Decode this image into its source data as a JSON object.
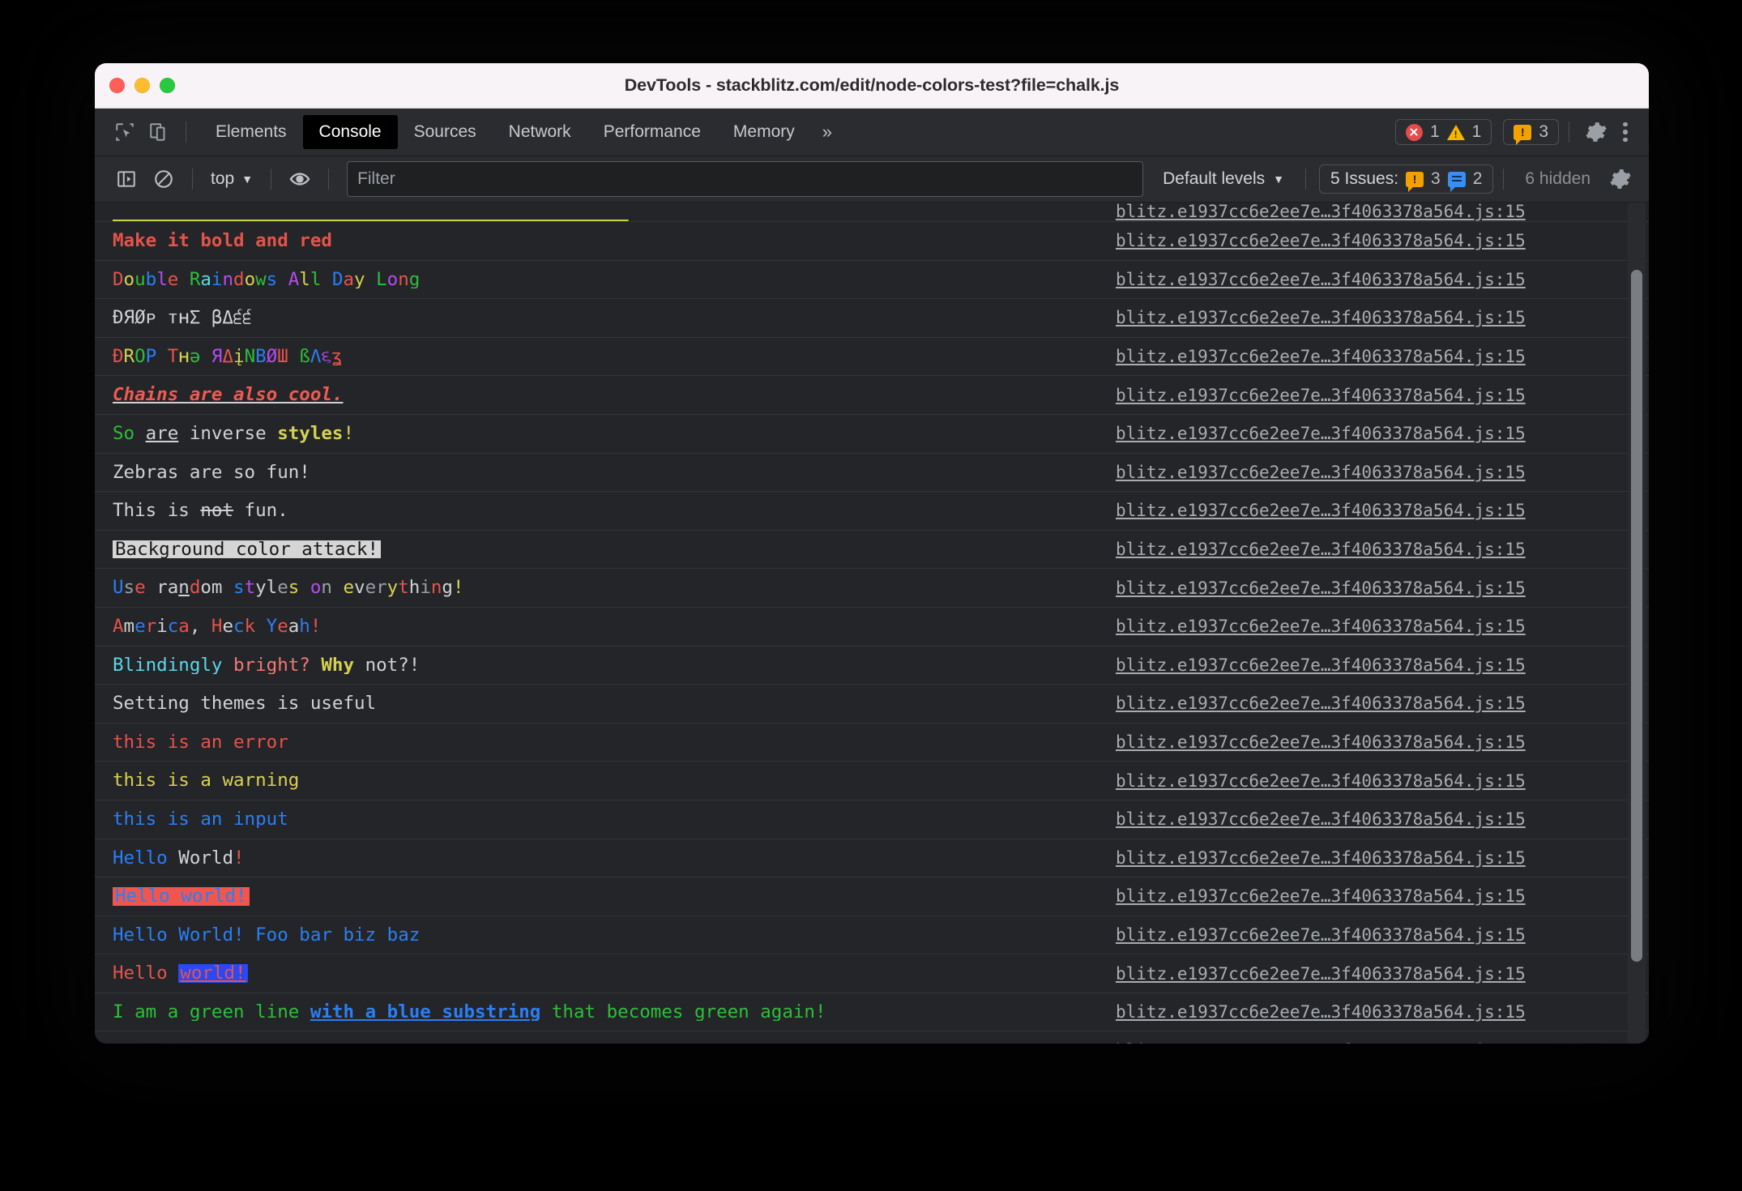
{
  "window": {
    "title": "DevTools - stackblitz.com/edit/node-colors-test?file=chalk.js",
    "traffic_lights": [
      "close",
      "minimize",
      "zoom"
    ]
  },
  "tabbar": {
    "inspect_icon": "inspect-element-icon",
    "device_icon": "device-toolbar-icon",
    "tabs": [
      {
        "label": "Elements",
        "active": false
      },
      {
        "label": "Console",
        "active": true
      },
      {
        "label": "Sources",
        "active": false
      },
      {
        "label": "Network",
        "active": false
      },
      {
        "label": "Performance",
        "active": false
      },
      {
        "label": "Memory",
        "active": false
      }
    ],
    "more_tabs": "»",
    "error_count": "1",
    "warning_count": "1",
    "issue_count": "3",
    "settings_icon": "gear-icon",
    "menu_icon": "kebab-menu-icon"
  },
  "console_toolbar": {
    "sidebar_icon": "console-sidebar-icon",
    "clear_icon": "clear-console-icon",
    "context": "top",
    "context_caret": "▼",
    "eye_icon": "live-expression-eye-icon",
    "filter_placeholder": "Filter",
    "filter_value": "",
    "levels": "Default levels",
    "levels_caret": "▼",
    "issues_label": "5 Issues:",
    "issues_warning_count": "3",
    "issues_info_count": "2",
    "hidden_label": "6 hidden",
    "settings_icon": "gear-icon"
  },
  "colors": {
    "red": "#e5534b",
    "bright_red": "#f05a52",
    "green": "#2fbd3a",
    "yellow": "#d7d152",
    "blue": "#2b7ef5",
    "magenta": "#b44bf0",
    "cyan": "#58d8e8",
    "white": "#d0d2d5",
    "gray": "#9aa0a6",
    "bg_highlight": "#d5d5d5",
    "bg_red": "#f0564e",
    "bg_blue": "#2b48f5"
  },
  "source_link": "blitz.e1937cc6e2ee7e…3f4063378a564.js:15",
  "messages": [
    {
      "id": "partial-top",
      "text": "",
      "partial": true
    },
    {
      "id": "make-it-bold-and-red",
      "text": "Make it bold and red"
    },
    {
      "id": "double-raindows",
      "text": "Double Raindows All Day Long"
    },
    {
      "id": "drop-the-bass",
      "text": "ÐЯØᴘ ᴛʜΣ βΔ੬੬"
    },
    {
      "id": "drop-the-rainbow-bass",
      "text": "ÐRÓP Tʜə ЯΔįÑBØШ ßΛ੬ʒ"
    },
    {
      "id": "chains-are-also-cool",
      "text": "Chains are also cool."
    },
    {
      "id": "so-are-inverse-styles",
      "text": "So are inverse styles!"
    },
    {
      "id": "zebras-are-so-fun",
      "text": "Zebras are so fun!"
    },
    {
      "id": "this-is-not-fun",
      "text": "This is not fun."
    },
    {
      "id": "background-color-attack",
      "text": "Background color attack!"
    },
    {
      "id": "use-random-styles",
      "text": "Use random styles on everything!"
    },
    {
      "id": "america-heck-yeah",
      "text": "America, Heck Yeah!"
    },
    {
      "id": "blindingly-bright",
      "text": "Blindingly bright? Why not?!"
    },
    {
      "id": "setting-themes-is-useful",
      "text": "Setting themes is useful"
    },
    {
      "id": "this-is-an-error",
      "text": "this is an error"
    },
    {
      "id": "this-is-a-warning",
      "text": "this is a warning"
    },
    {
      "id": "this-is-an-input",
      "text": "this is an input"
    },
    {
      "id": "hello-world-1",
      "text": "Hello World!"
    },
    {
      "id": "hello-world-2",
      "text": "Hello world!"
    },
    {
      "id": "hello-world-foo-bar",
      "text": "Hello World! Foo bar biz baz"
    },
    {
      "id": "hello-world-3",
      "text": "Hello world!"
    },
    {
      "id": "green-line-blue-substring",
      "text": "I am a green line with a blue substring that becomes green again!"
    },
    {
      "id": "tail-row",
      "text": ""
    }
  ],
  "scrollbar": {
    "thumb_top_pct": 8,
    "thumb_height_pct": 82
  }
}
